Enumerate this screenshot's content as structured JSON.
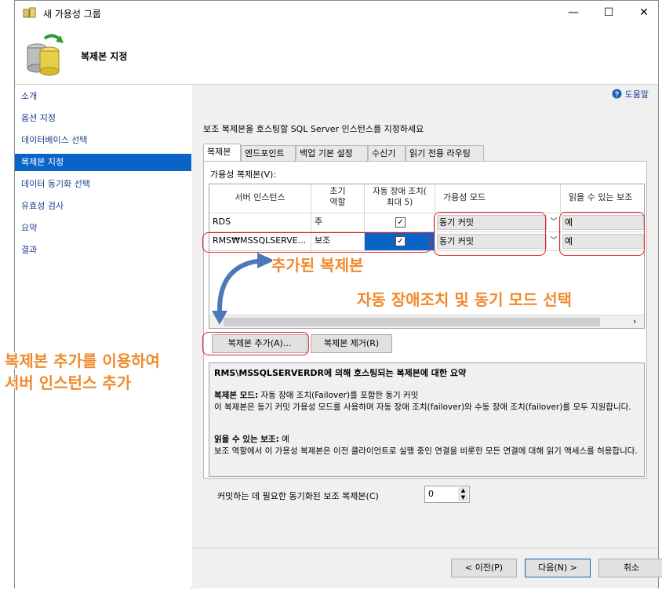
{
  "window": {
    "title": "새 가용성 그룹",
    "header_title": "복제본 지정",
    "controls": {
      "minimize": "—",
      "maximize": "☐",
      "close": "✕"
    }
  },
  "sidebar": {
    "items": [
      {
        "label": "소개"
      },
      {
        "label": "옵션 지정"
      },
      {
        "label": "데이터베이스 선택"
      },
      {
        "label": "복제본 지정",
        "active": true
      },
      {
        "label": "데이터 동기화 선택"
      },
      {
        "label": "유효성 검사"
      },
      {
        "label": "요약"
      },
      {
        "label": "결과"
      }
    ]
  },
  "help": {
    "label": "도움말"
  },
  "instruction": "보조 복제본을 호스팅할 SQL Server 인스턴스를 지정하세요",
  "tabs": [
    {
      "label": "복제본",
      "active": true
    },
    {
      "label": "엔드포인트"
    },
    {
      "label": "백업 기본 설정"
    },
    {
      "label": "수신기"
    },
    {
      "label": "읽기 전용 라우팅"
    }
  ],
  "replicas_label": "가용성 복제본(V):",
  "table": {
    "headers": [
      "서버 인스턴스",
      "초기\n역할",
      "자동 장애 조치(\n최대 5)",
      "가용성 모드",
      "읽을 수 있는 보조"
    ],
    "rows": [
      {
        "server": "RDS",
        "role": "주",
        "auto_failover": true,
        "mode": "동기 커밋",
        "readable": "예"
      },
      {
        "server": "RMS₩MSSQLSERVE...",
        "role": "보조",
        "auto_failover": true,
        "mode": "동기 커밋",
        "readable": "예"
      }
    ]
  },
  "buttons": {
    "add_replica": "복제본 추가(A)...",
    "remove_replica": "복제본 제거(R)",
    "prev": "< 이전(P)",
    "next": "다음(N) >",
    "cancel": "취소"
  },
  "summary": {
    "title": "RMS\\MSSQLSERVERDR에 의해 호스팅되는 복제본에 대한 요약",
    "mode_label": "복제본 모드:",
    "mode_value": " 자동 장애 조치(Failover)를 포함한 동기 커밋",
    "mode_desc": "이 복제본은 동기 커밋 가용성 모드를 사용하며 자동 장애 조치(failover)와 수동 장애 조치(failover)를 모두 지원합니다.",
    "readable_label": "읽을 수 있는 보조:",
    "readable_value": " 예",
    "readable_desc": "보조 역할에서 이 가용성 복제본은 이전 클라이언트로 실행 중인 연결을 비롯한 모든 연결에 대해 읽기 액세스를 허용합니다."
  },
  "sync_replicas": {
    "label": "커밋하는 데 필요한 동기화된 보조 복제본(C)",
    "value": "0"
  },
  "annotations": {
    "added_replica": "추가된 복제본",
    "auto_failover_sync": "자동 장애조치 및 동기 모드 선택",
    "add_replica_line1": "복제본 추가를 이용하여",
    "add_replica_line2": "서버 인스턴스 추가"
  },
  "colors": {
    "accent": "#0a64c8",
    "annotation": "#f08a2e",
    "highlight_box": "#e0202a"
  }
}
